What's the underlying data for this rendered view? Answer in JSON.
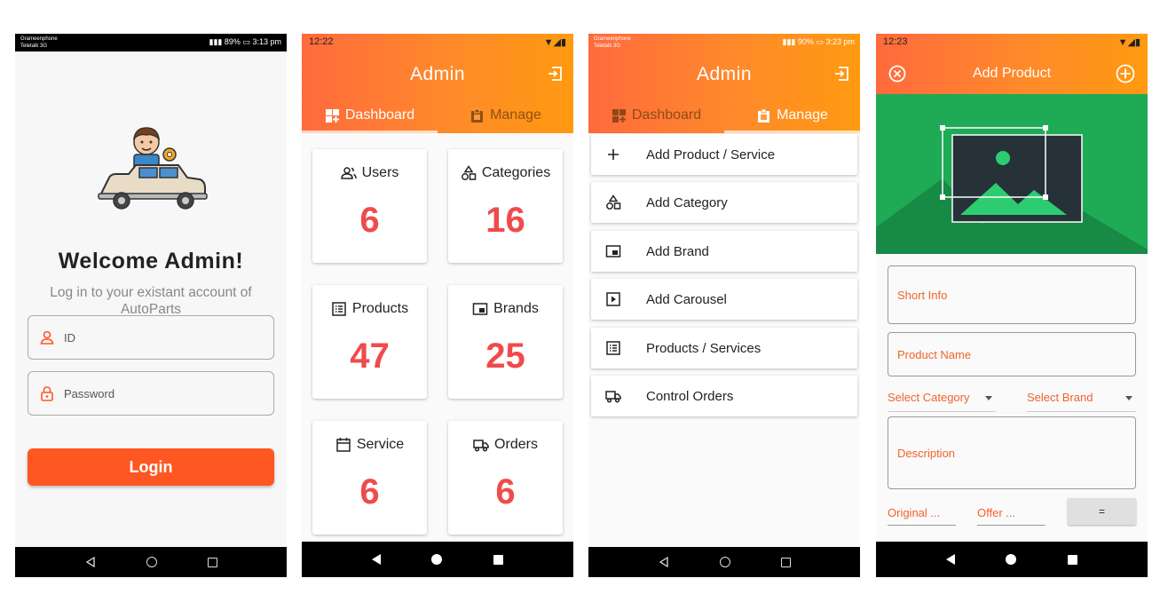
{
  "colors": {
    "accent": "#ff5722",
    "number_red": "#f04b4b",
    "field_orange": "#f0632c",
    "green_area": "#1faa55"
  },
  "screen1": {
    "status": {
      "carrier1": "Grameenphone",
      "carrier2": "Teletalk 3G",
      "battery": "89%",
      "time": "3:13 pm"
    },
    "welcome": "Welcome Admin!",
    "subtitle": "Log in to your existant account of AutoParts",
    "id_placeholder": "ID",
    "password_placeholder": "Password",
    "login_label": "Login"
  },
  "screen2": {
    "status_time": "12:22",
    "title": "Admin",
    "tabs": [
      "Dashboard",
      "Manage"
    ],
    "cards": [
      {
        "label": "Users",
        "value": "6",
        "icon": "users-icon"
      },
      {
        "label": "Categories",
        "value": "16",
        "icon": "shapes-icon"
      },
      {
        "label": "Products",
        "value": "47",
        "icon": "list-icon"
      },
      {
        "label": "Brands",
        "value": "25",
        "icon": "picture-in-picture-icon"
      },
      {
        "label": "Service",
        "value": "6",
        "icon": "calendar-icon"
      },
      {
        "label": "Orders",
        "value": "6",
        "icon": "truck-icon"
      }
    ]
  },
  "screen3": {
    "status": {
      "carrier1": "Grameenphone",
      "carrier2": "Teletalk 3G",
      "battery": "90%",
      "time": "3:23 pm"
    },
    "title": "Admin",
    "tabs": [
      "Dashboard",
      "Manage"
    ],
    "items": [
      {
        "label": "Add Product / Service",
        "icon": "plus-icon"
      },
      {
        "label": "Add Category",
        "icon": "shapes-icon"
      },
      {
        "label": "Add Brand",
        "icon": "picture-in-picture-icon"
      },
      {
        "label": "Add Carousel",
        "icon": "play-box-icon"
      },
      {
        "label": "Products / Services",
        "icon": "list-icon"
      },
      {
        "label": "Control Orders",
        "icon": "truck-icon"
      }
    ]
  },
  "screen4": {
    "status_time": "12:23",
    "title": "Add Product",
    "short_info": "Short Info",
    "product_name": "Product Name",
    "select_category": "Select Category",
    "select_brand": "Select Brand",
    "description": "Description",
    "original": "Original ...",
    "offer": "Offer ...",
    "equals": "="
  }
}
